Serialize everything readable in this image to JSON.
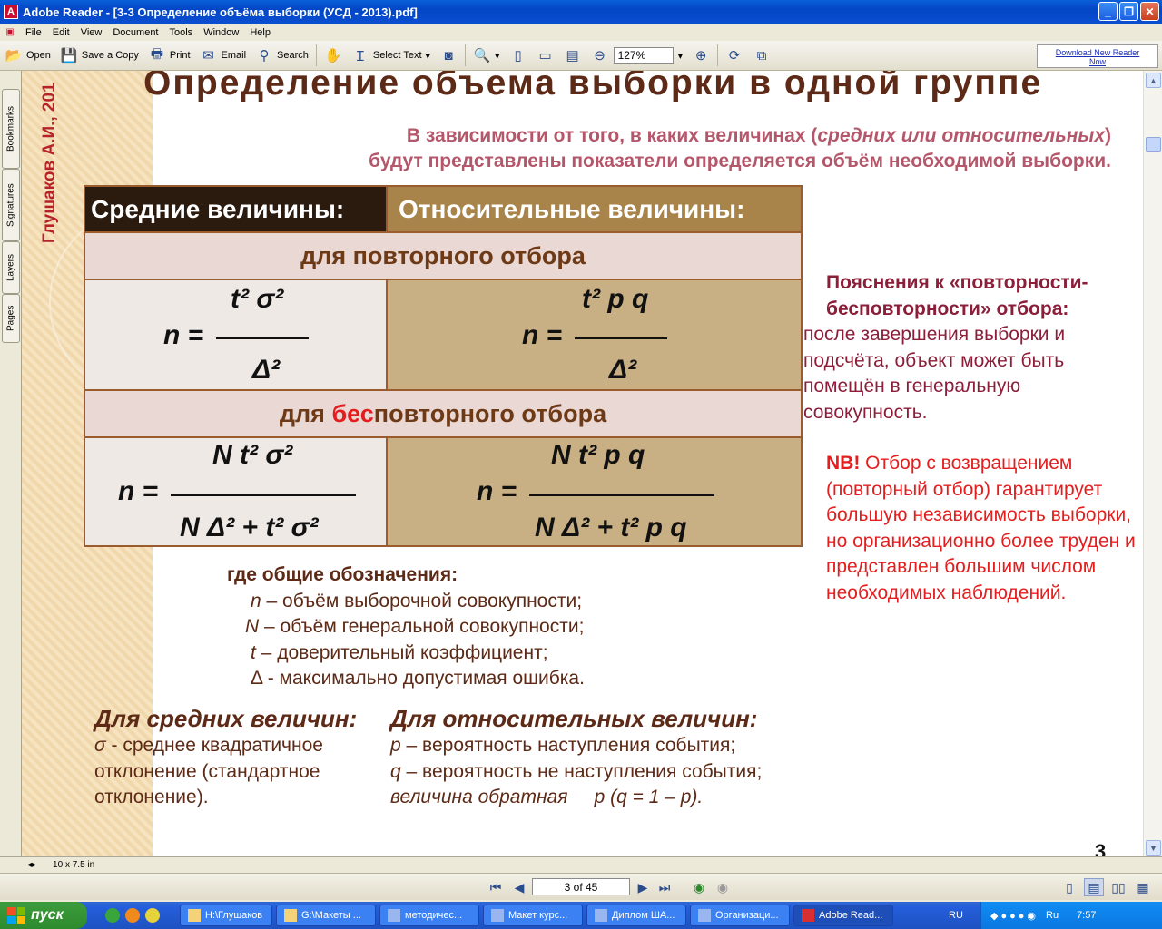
{
  "window": {
    "title": "Adobe Reader - [3-3 Определение объёма выборки (УСД - 2013).pdf]",
    "app_icon": "adobe-reader-icon"
  },
  "menu": [
    "File",
    "Edit",
    "View",
    "Document",
    "Tools",
    "Window",
    "Help"
  ],
  "toolbar": {
    "open_label": "Open",
    "save_label": "Save a Copy",
    "print_label": "Print",
    "email_label": "Email",
    "search_label": "Search",
    "select_text_label": "Select Text",
    "zoom_value": "127%",
    "download_line1": "Download New Reader",
    "download_line2": "Now"
  },
  "navtabs": [
    "Bookmarks",
    "Signatures",
    "Layers",
    "Pages"
  ],
  "slide": {
    "author": "Глушаков А.И., 201",
    "heading": "Определение  объема  выборки   в  одной   группе",
    "subtitle_line1_a": "В  зависимости от  того, в каких величинах  (",
    "subtitle_line1_i": "средних или относительных",
    "subtitle_line1_b": ")",
    "subtitle_line2": "будут  представлены показатели  определяется  объём необходимой выборки.",
    "col_left": "Средние   величины:",
    "col_right": "Относительные   величины:",
    "row1_label": "для   повторного  отбора",
    "row2_pre": "для   ",
    "row2_red": "бес",
    "row2_post": "повторного  отбора",
    "f1_num": "t² σ²",
    "f1_lhs": "n =",
    "f1_den": "Δ²",
    "f2_num": "t² p q",
    "f2_lhs": "n =",
    "f2_den": "Δ²",
    "f3_num": "N t² σ²",
    "f3_lhs": "n =",
    "f3_den": "N Δ² + t² σ²",
    "f4_num": "N t² p q",
    "f4_lhs": "n =",
    "f4_den": "N Δ² + t² p q",
    "notes_head": "Пояснения к «повторности-бесповторности» отбора:",
    "notes_body": "после завершения выборки и подсчёта, объект может быть помещён в генеральную совокупность.",
    "nb_label": "NB!",
    "nb_body": "Отбор с возвращением (повторный отбор) гарантирует большую независимость выборки, но организационно более труден и представлен большим числом необходимых наблюдений.",
    "legend_head": "где общие обозначения:",
    "legend": [
      {
        "sym": "n",
        "text": " – объём выборочной совокупности;"
      },
      {
        "sym": "N",
        "text": " – объём генеральной совокупности;"
      },
      {
        "sym": "t",
        "text": " – доверительный коэффициент;"
      },
      {
        "sym": "Δ",
        "text": " - максимально допустимая ошибка."
      }
    ],
    "left_head": "Для средних величин:",
    "left_sym": "σ",
    "left_text": " - среднее квадратичное",
    "left_text2": "отклонение (стандартное",
    "left_text3": "отклонение).",
    "right_head": "Для относительных величин:",
    "right_p": "p",
    "right_p_text": " – вероятность наступления события;",
    "right_q": "q",
    "right_q_text": " – вероятность не наступления события;",
    "right_inv": "величина  обратная",
    "right_inv2": "p  (q = 1 – p).",
    "page_number": "3"
  },
  "status": {
    "page_size": "10 x 7.5 in"
  },
  "pagenav": {
    "page_label": "3 of 45"
  },
  "taskbar": {
    "start": "пуск",
    "tasks": [
      "H:\\Глушаков",
      "G:\\Макеты ...",
      "методичес...",
      "Макет курс...",
      "Диплом ША...",
      "Организаци...",
      "Adobe Read..."
    ],
    "lang": "RU",
    "tray_lang": "Ru",
    "clock": "7:57"
  },
  "colors": {
    "title_blue": "#0346c6",
    "slide_brown": "#5c2a16",
    "accent_red": "#e41e1e",
    "note_maroon": "#8b1f3a"
  }
}
